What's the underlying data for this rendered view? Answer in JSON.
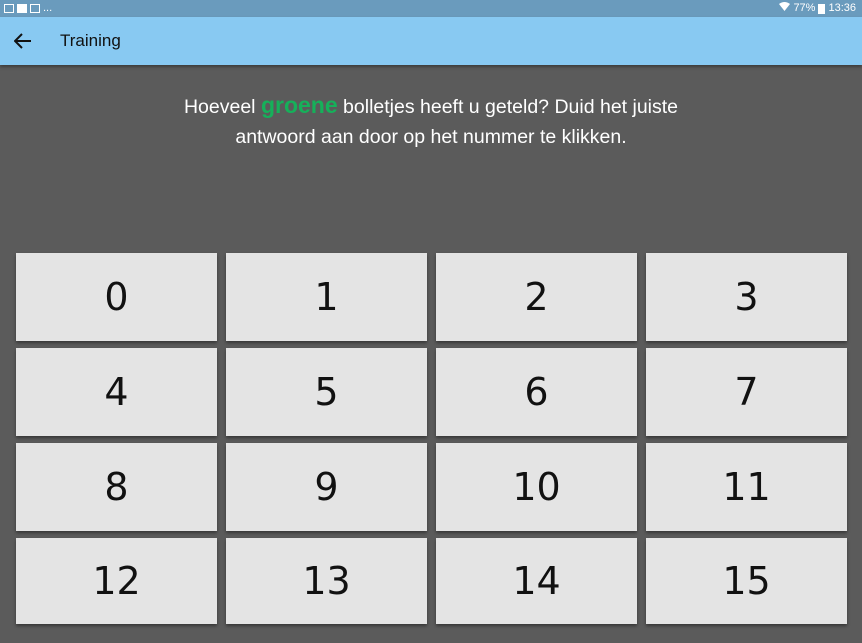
{
  "status_bar": {
    "left_dots": "...",
    "battery": "77%",
    "time": "13:36"
  },
  "app_bar": {
    "back_icon": "arrow-left-icon",
    "title": "Training"
  },
  "question": {
    "part1": "Hoeveel ",
    "highlight": "groene",
    "highlight_color": "#16b05a",
    "part2": " bolletjes heeft u geteld? Duid het juiste",
    "line2": "antwoord aan door op het nummer te klikken."
  },
  "answers": [
    "0",
    "1",
    "2",
    "3",
    "4",
    "5",
    "6",
    "7",
    "8",
    "9",
    "10",
    "11",
    "12",
    "13",
    "14",
    "15"
  ]
}
